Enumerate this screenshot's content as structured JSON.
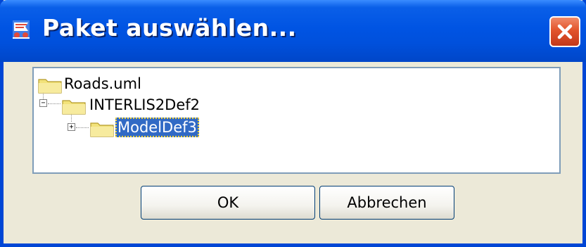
{
  "window": {
    "title": "Paket auswählen...",
    "app_icon": "app-icon",
    "close_icon": "close-icon"
  },
  "tree": {
    "nodes": [
      {
        "label": "Roads.uml",
        "icon": "folder-icon",
        "expander": null,
        "selected": false
      },
      {
        "label": "INTERLIS2Def2",
        "icon": "folder-icon",
        "expander": "−",
        "selected": false
      },
      {
        "label": "ModelDef3",
        "icon": "folder-icon",
        "expander": "+",
        "selected": true
      }
    ]
  },
  "buttons": {
    "ok_label": "OK",
    "cancel_label": "Abbrechen"
  },
  "colors": {
    "titlebar": "#0054e3",
    "close": "#e2542b",
    "selection": "#316ac5",
    "folder": "#f2e27a"
  }
}
